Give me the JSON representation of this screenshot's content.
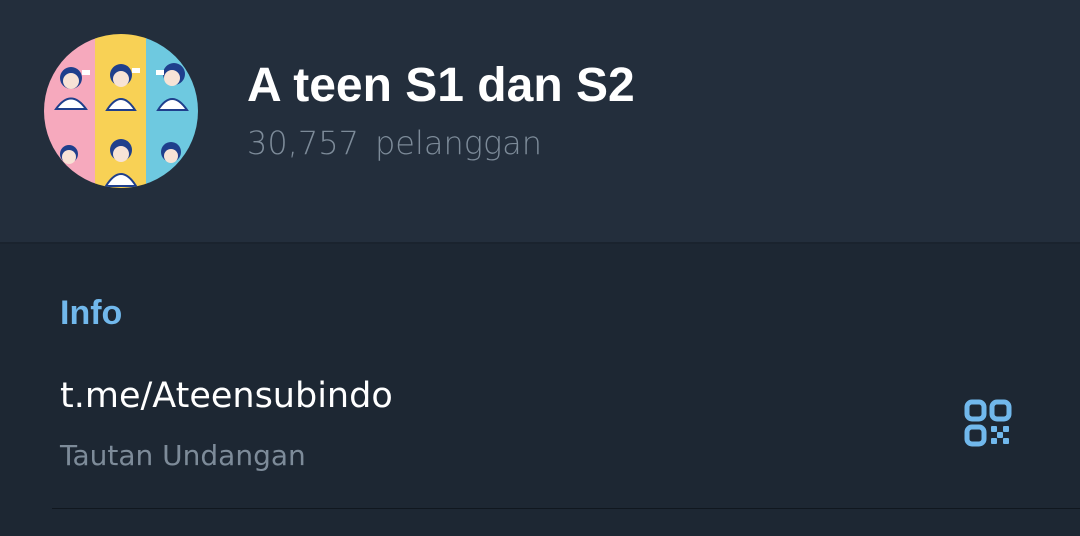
{
  "channel": {
    "title": "A teen S1 dan S2",
    "subscriber_count": "30,757",
    "subscriber_label": "pelanggan",
    "avatar_colors": [
      "#f6a9bd",
      "#f8d155",
      "#6ec9e0"
    ]
  },
  "info": {
    "section_title": "Info",
    "link": "t.me/Ateensubindo",
    "link_caption": "Tautan Undangan",
    "qr_icon": "qr-code-icon",
    "accent_color": "#71b8ec"
  }
}
